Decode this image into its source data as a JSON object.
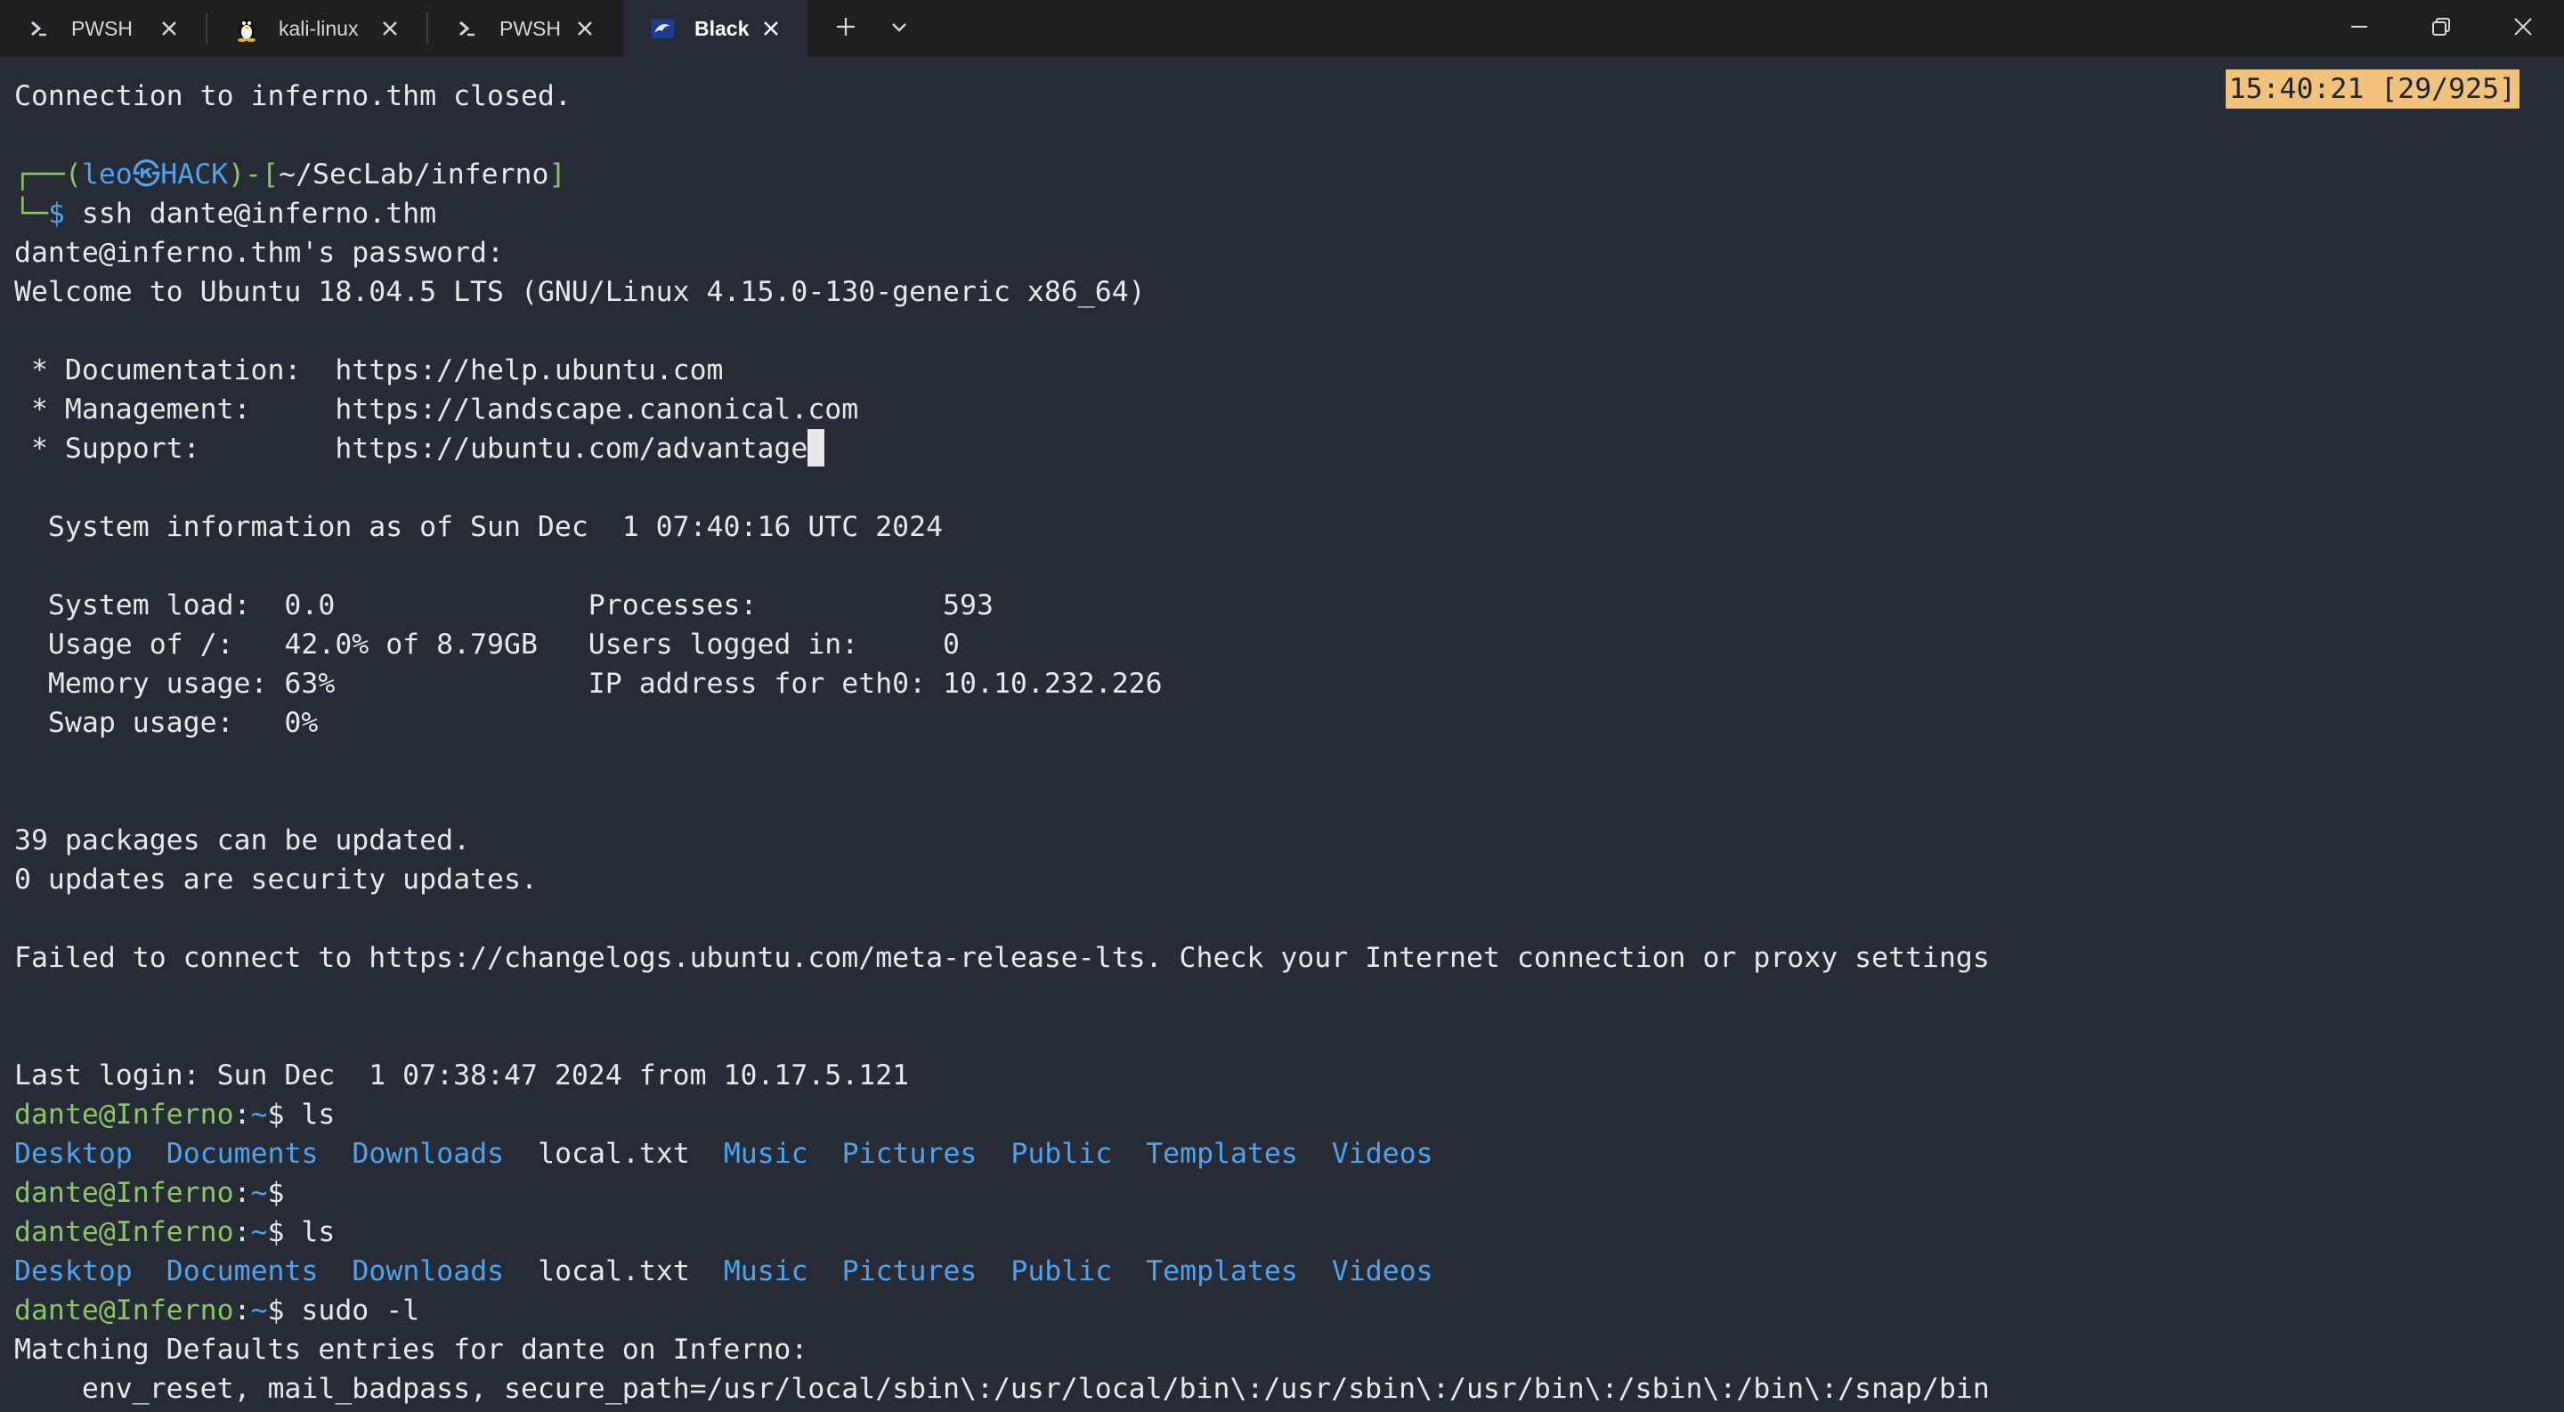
{
  "tabs": [
    {
      "label": "PWSH",
      "icon": "powershell-icon"
    },
    {
      "label": "kali-linux",
      "icon": "linux-penguin-icon"
    },
    {
      "label": "PWSH",
      "icon": "powershell-icon"
    },
    {
      "label": "Black",
      "icon": "kali-dragon-icon",
      "active": true
    }
  ],
  "tabbar": {
    "new_tab_icon": "plus-icon",
    "dropdown_icon": "chevron-down-icon"
  },
  "window_controls": [
    "minimize-icon",
    "restore-icon",
    "close-icon"
  ],
  "colors": {
    "terminal_bg": "#262b36",
    "tabbar_bg": "#1f1f1f",
    "prompt_green": "#8cc664",
    "directory_blue": "#4fa3ee",
    "clock_bg": "#f1c27c"
  },
  "terminal": {
    "clock": "15:40:21 [29/925]",
    "connection_closed": "Connection to inferno.thm closed.",
    "kali_prompt": {
      "corner_top": "┌──(",
      "user": "leo",
      "at": "㉿",
      "host": "HACK",
      "mid": ")-[",
      "path": "~/SecLab/inferno",
      "end": "]",
      "corner_bottom": "└─",
      "dollar": "$",
      "command": " ssh dante@inferno.thm"
    },
    "password_prompt": "dante@inferno.thm's password:",
    "welcome": "Welcome to Ubuntu 18.04.5 LTS (GNU/Linux 4.15.0-130-generic x86_64)",
    "links": [
      {
        "label": " * Documentation:  ",
        "url": "https://help.ubuntu.com"
      },
      {
        "label": " * Management:     ",
        "url": "https://landscape.canonical.com"
      },
      {
        "label": " * Support:        ",
        "url": "https://ubuntu.com/advantage"
      }
    ],
    "sysinfo_header": "  System information as of Sun Dec  1 07:40:16 UTC 2024",
    "sysinfo": [
      "  System load:  0.0               Processes:           593",
      "  Usage of /:   42.0% of 8.79GB   Users logged in:     0",
      "  Memory usage: 63%               IP address for eth0: 10.10.232.226",
      "  Swap usage:   0%"
    ],
    "packages": "39 packages can be updated.",
    "security": "0 updates are security updates.",
    "failed": "Failed to connect to https://changelogs.ubuntu.com/meta-release-lts. Check your Internet connection or proxy settings",
    "last_login": "Last login: Sun Dec  1 07:38:47 2024 from 10.17.5.121",
    "remote_prompt": {
      "user_host": "dante@Inferno",
      "colon": ":",
      "path": "~",
      "dollar": "$"
    },
    "commands": {
      "ls": " ls",
      "empty": "",
      "sudo": " sudo -l"
    },
    "ls_entries": [
      {
        "name": "Desktop",
        "type": "dir"
      },
      {
        "name": "Documents",
        "type": "dir"
      },
      {
        "name": "Downloads",
        "type": "dir"
      },
      {
        "name": "local.txt",
        "type": "file"
      },
      {
        "name": "Music",
        "type": "dir"
      },
      {
        "name": "Pictures",
        "type": "dir"
      },
      {
        "name": "Public",
        "type": "dir"
      },
      {
        "name": "Templates",
        "type": "dir"
      },
      {
        "name": "Videos",
        "type": "dir"
      }
    ],
    "matching_defaults": "Matching Defaults entries for dante on Inferno:",
    "env_line": "    env_reset, mail_badpass, secure_path=/usr/local/sbin\\:/usr/local/bin\\:/usr/sbin\\:/usr/bin\\:/sbin\\:/bin\\:/snap/bin"
  }
}
